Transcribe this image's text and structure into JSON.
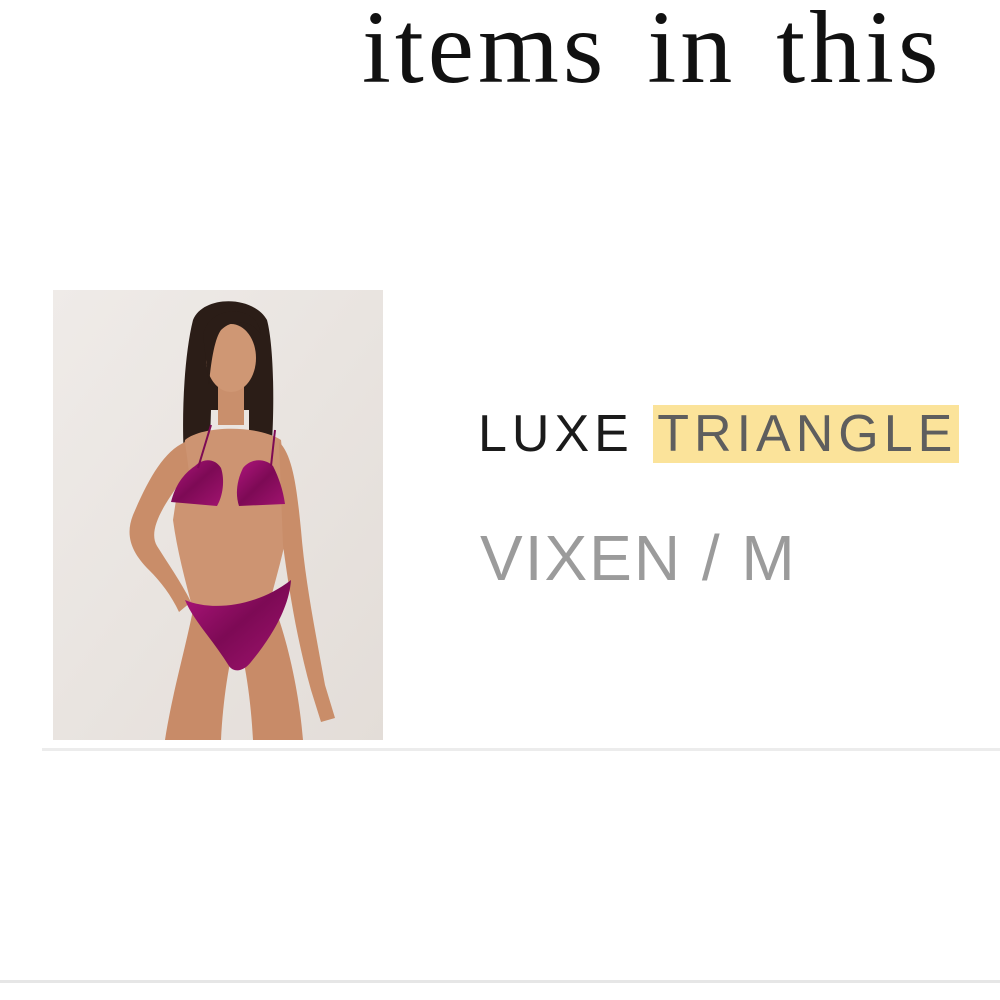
{
  "heading": "items in this",
  "item": {
    "name_prefix": "LUXE",
    "name_highlight": "TRIANGLE",
    "variant": "VIXEN / M",
    "image_icon": "product-photo",
    "highlight_color": "#fbe39a"
  }
}
